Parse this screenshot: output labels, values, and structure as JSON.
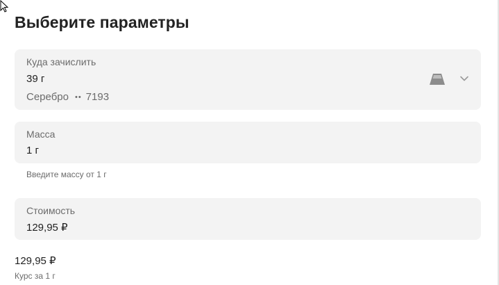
{
  "page": {
    "title": "Выберите параметры"
  },
  "destination": {
    "label": "Куда зачислить",
    "value": "39 г",
    "account_type": "Серебро",
    "account_mask": "••",
    "account_number": "7193",
    "icon": "metal-bar-icon",
    "expand_icon": "chevron-down-icon"
  },
  "mass": {
    "label": "Масса",
    "value": "1 г",
    "hint": "Введите массу от 1 г"
  },
  "cost": {
    "label": "Стоимость",
    "value": "129,95 ₽"
  },
  "rate": {
    "value": "129,95 ₽",
    "label": "Курс за 1 г"
  },
  "colors": {
    "card_background": "#f3f3f3",
    "muted_text": "#6b6b6b",
    "primary_text": "#1f1f1f",
    "icon": "#8c8c8c"
  }
}
